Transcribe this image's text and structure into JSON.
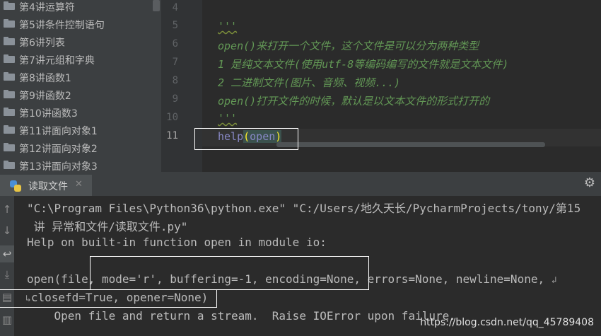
{
  "sidebar": {
    "items": [
      {
        "label": "第4讲运算符"
      },
      {
        "label": "第5讲条件控制语句"
      },
      {
        "label": "第6讲列表"
      },
      {
        "label": "第7讲元组和字典"
      },
      {
        "label": "第8讲函数1"
      },
      {
        "label": "第9讲函数2"
      },
      {
        "label": "第10讲函数3"
      },
      {
        "label": "第11讲面向对象1"
      },
      {
        "label": "第12讲面向对象2"
      },
      {
        "label": "第13讲面向对象3"
      }
    ]
  },
  "editor": {
    "line_numbers": [
      "4",
      "5",
      "6",
      "7",
      "8",
      "9",
      "10",
      "11"
    ],
    "current_line": "11",
    "lines": {
      "l5": "'''",
      "l6": "open()来打开一个文件，这个文件是可以分为两种类型",
      "l7": "1 是纯文本文件(使用utf-8等编码编写的文件就是文本文件)",
      "l8": "2 二进制文件(图片、音频、视频...)",
      "l9": "open()打开文件的时候，默认是以文本文件的形式打开的",
      "l10": "'''",
      "l11_fn": "help",
      "l11_open_paren": "(",
      "l11_arg": "open",
      "l11_close_paren": ")"
    }
  },
  "run_panel": {
    "tab_label": "读取文件",
    "close_icon": "close-icon",
    "settings_icon": "gear-icon",
    "tools": [
      "arrow-up-icon",
      "arrow-down-icon",
      "soft-wrap-icon",
      "scroll-to-end-icon",
      "print-icon",
      "trash-icon"
    ]
  },
  "console": {
    "lines": {
      "c1": "\"C:\\Program Files\\Python36\\python.exe\" \"C:/Users/地久天长/PycharmProjects/tony/第15",
      "c2": " 讲 异常和文件/读取文件.py\"",
      "c3": "Help on built-in function open in module io:",
      "c4": "open(file, mode='r', buffering=-1, encoding=None, errors=None, newline=None, ",
      "c4_wrap": "↲",
      "c5_wrap": "↳",
      "c5": "closefd=True, opener=None)",
      "c6": "    Open file and return a stream.  Raise IOError upon failure."
    }
  },
  "watermark": "https://blog.csdn.net/qq_45789408",
  "colors": {
    "editor_bg": "#2b2b2b",
    "docstring": "#629755",
    "builtin": "#8888c6",
    "highlight_box": "#ffffff"
  }
}
